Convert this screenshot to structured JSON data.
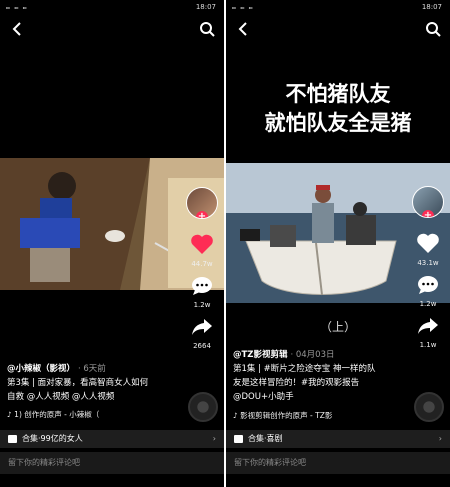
{
  "left": {
    "status": {
      "network": "⫭ ⫭ ⫭",
      "time": "18:07"
    },
    "sidebar": {
      "likes": "44.7w",
      "comments": "1.2w",
      "shares": "2664"
    },
    "author": "@小辣椒（影视）",
    "time": "· 6天前",
    "caption_line1": "第3集 | 面对家暴，看高智商女人如何",
    "caption_line2": "自救 @人人视频 @人人视频",
    "music": "♪ 1) 创作的原声 - 小辣椒（",
    "collection": "合集·99亿的女人",
    "comment_placeholder": "留下你的精彩评论吧"
  },
  "right": {
    "status": {
      "network": "⫭ ⫭ ⫭",
      "time": "18:07"
    },
    "headline_line1": "不怕猪队友",
    "headline_line2": "就怕队友全是猪",
    "episode_label": "（上）",
    "sidebar": {
      "likes": "43.1w",
      "comments": "1.2w",
      "shares": "1.1w"
    },
    "author": "@TZ影视剪辑",
    "time": "· 04月03日",
    "caption_line1": "第1集 | #断片之险途夺宝 神一样的队",
    "caption_line2": "友是这样冒险的！#我的观影报告",
    "caption_line3": "@DOU+小助手",
    "music": "♪ 影视剪辑创作的原声 - TZ影",
    "collection": "合集·喜剧",
    "comment_placeholder": "留下你的精彩评论吧"
  },
  "colors": {
    "like": "#fe2c55",
    "background": "#000000"
  }
}
